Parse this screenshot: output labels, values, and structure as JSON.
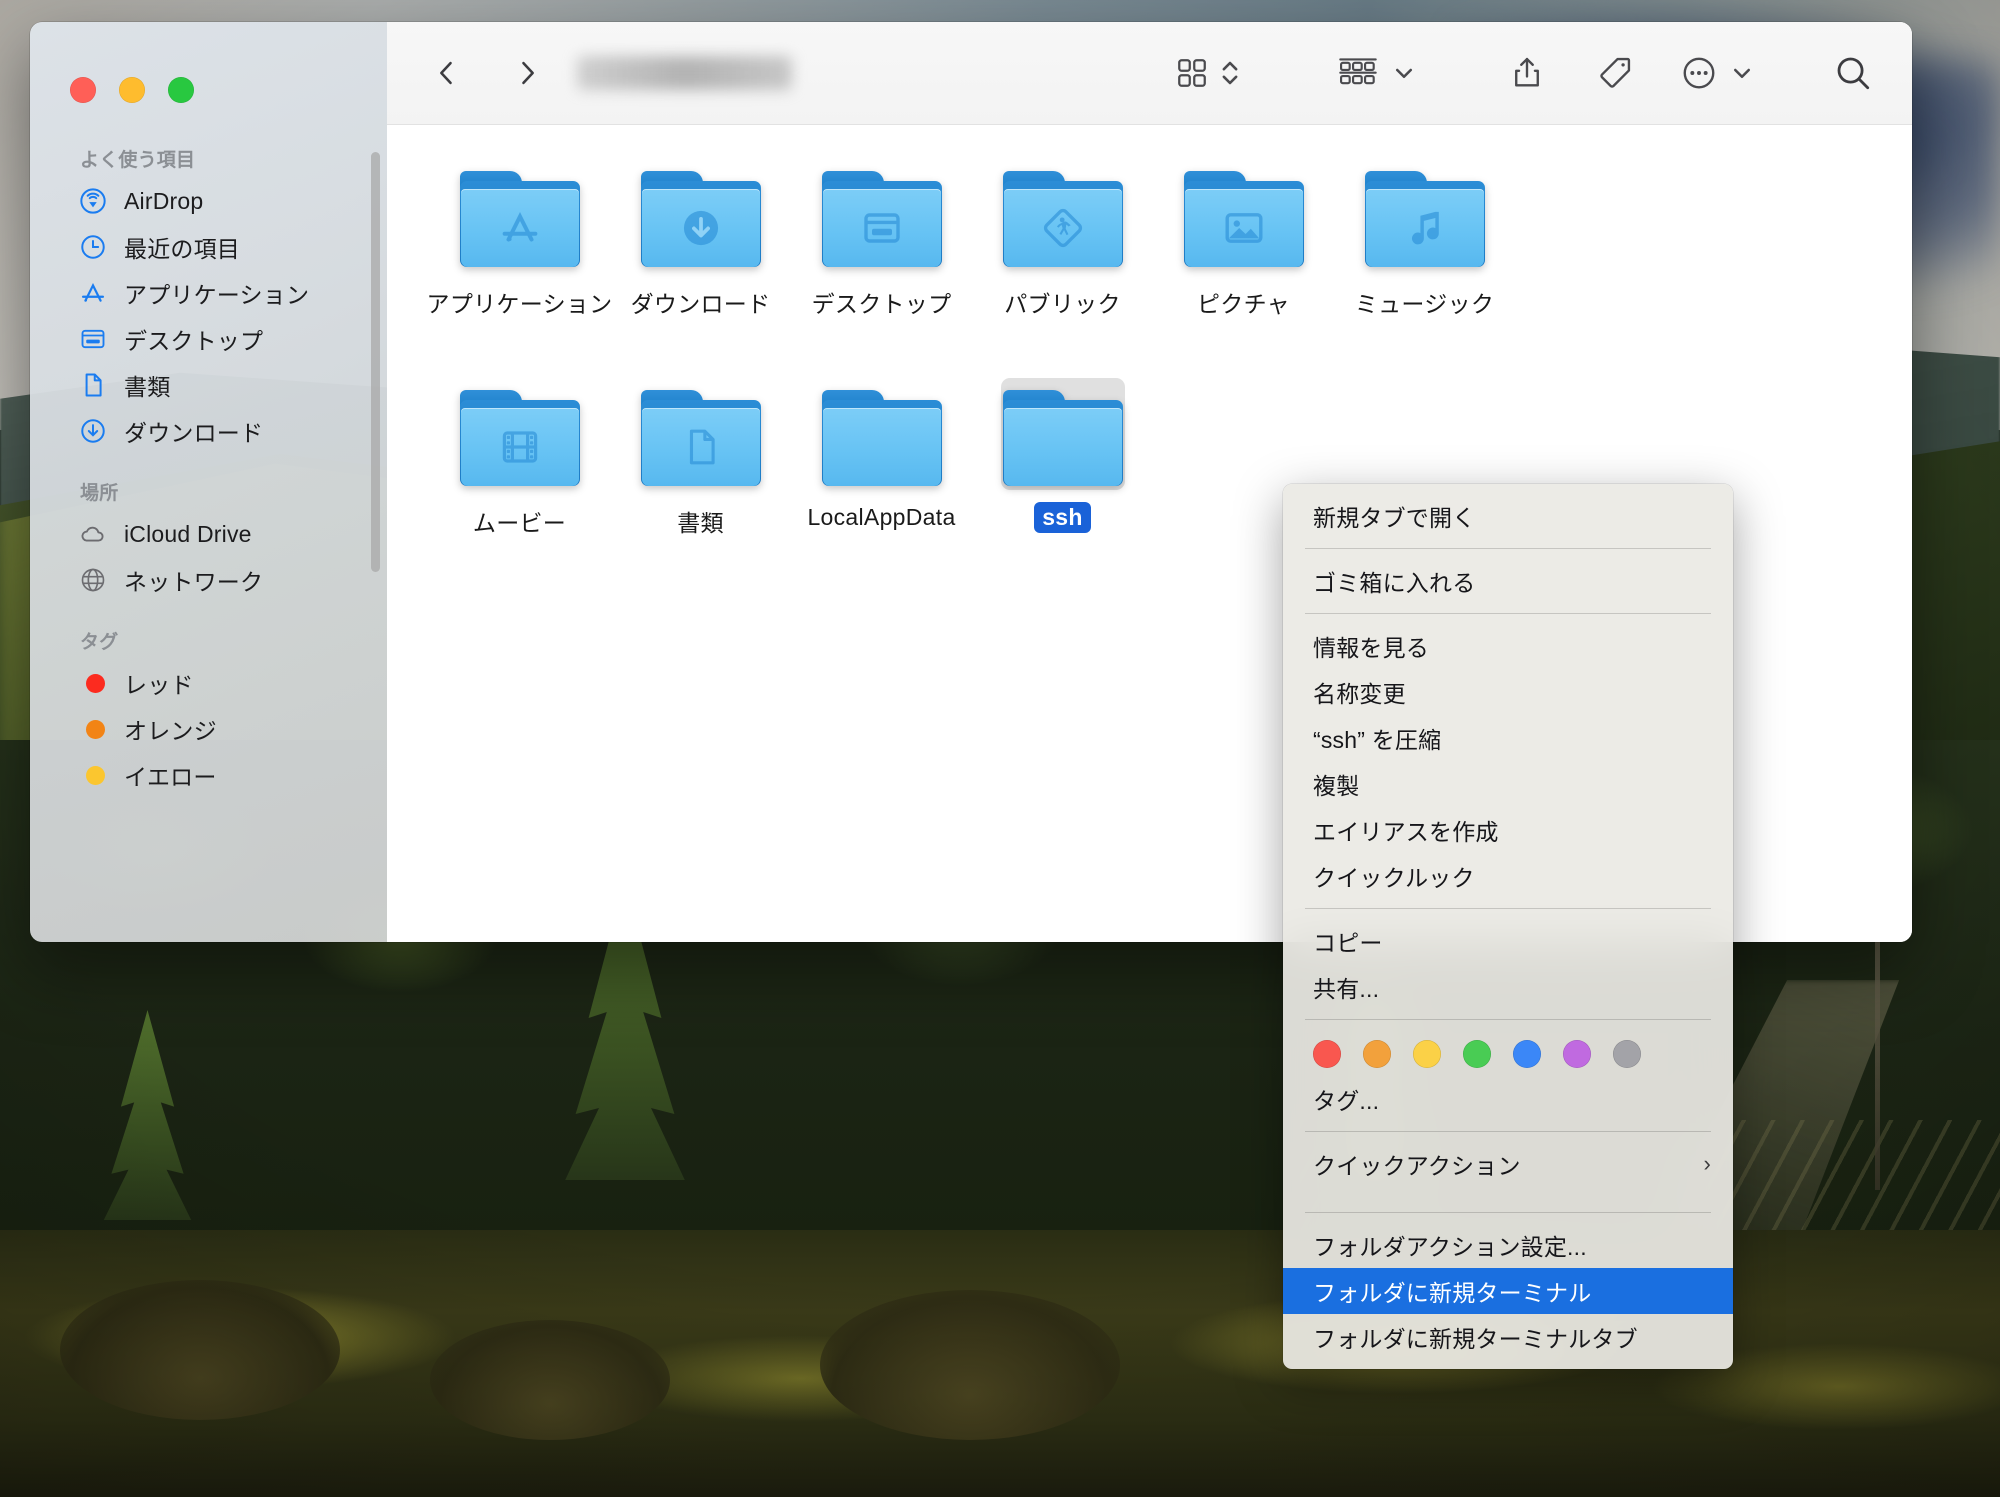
{
  "window": {
    "traffic_lights": [
      "close",
      "minimize",
      "zoom"
    ],
    "path_title_redacted": ""
  },
  "sidebar": {
    "sections": [
      {
        "heading": "よく使う項目",
        "items": [
          {
            "label": "AirDrop",
            "icon": "airdrop-icon"
          },
          {
            "label": "最近の項目",
            "icon": "clock-icon"
          },
          {
            "label": "アプリケーション",
            "icon": "appstore-icon"
          },
          {
            "label": "デスクトップ",
            "icon": "desktop-icon"
          },
          {
            "label": "書類",
            "icon": "document-icon"
          },
          {
            "label": "ダウンロード",
            "icon": "download-icon"
          }
        ]
      },
      {
        "heading": "場所",
        "items": [
          {
            "label": "iCloud Drive",
            "icon": "cloud-icon"
          },
          {
            "label": "ネットワーク",
            "icon": "globe-icon"
          }
        ]
      },
      {
        "heading": "タグ",
        "items": [
          {
            "label": "レッド",
            "icon": "tag-dot-icon",
            "color": "#fc2b1f"
          },
          {
            "label": "オレンジ",
            "icon": "tag-dot-icon",
            "color": "#f28415"
          },
          {
            "label": "イエロー",
            "icon": "tag-dot-icon",
            "color": "#fbc62f"
          }
        ]
      }
    ]
  },
  "toolbar": {
    "back": "back-icon",
    "forward": "forward-icon",
    "view_mode": "icon-view-icon",
    "view_stepper": "stepper-icon",
    "group_by": "group-by-icon",
    "group_chevron": "chevron-down-icon",
    "share": "share-icon",
    "tags": "tag-icon",
    "more": "ellipsis-circle-icon",
    "more_chevron": "chevron-down-icon",
    "search": "search-icon"
  },
  "files": {
    "rows": [
      [
        {
          "name": "アプリケーション",
          "icon": "folder-applications",
          "selected": false
        },
        {
          "name": "ダウンロード",
          "icon": "folder-downloads",
          "selected": false
        },
        {
          "name": "デスクトップ",
          "icon": "folder-desktop",
          "selected": false
        },
        {
          "name": "パブリック",
          "icon": "folder-public",
          "selected": false
        },
        {
          "name": "ピクチャ",
          "icon": "folder-pictures",
          "selected": false
        },
        {
          "name": "ミュージック",
          "icon": "folder-music",
          "selected": false
        }
      ],
      [
        {
          "name": "ムービー",
          "icon": "folder-movies",
          "selected": false
        },
        {
          "name": "書類",
          "icon": "folder-documents",
          "selected": false
        },
        {
          "name": "LocalAppData",
          "icon": "folder-plain",
          "selected": false
        },
        {
          "name": "ssh",
          "icon": "folder-plain",
          "selected": true
        }
      ]
    ]
  },
  "context_menu": {
    "items": [
      {
        "label": "新規タブで開く",
        "type": "item"
      },
      {
        "type": "separator"
      },
      {
        "label": "ゴミ箱に入れる",
        "type": "item"
      },
      {
        "type": "separator"
      },
      {
        "label": "情報を見る",
        "type": "item"
      },
      {
        "label": "名称変更",
        "type": "item"
      },
      {
        "label": "“ssh” を圧縮",
        "type": "item"
      },
      {
        "label": "複製",
        "type": "item"
      },
      {
        "label": "エイリアスを作成",
        "type": "item"
      },
      {
        "label": "クイックルック",
        "type": "item"
      },
      {
        "type": "separator"
      },
      {
        "label": "コピー",
        "type": "item"
      },
      {
        "label": "共有...",
        "type": "item"
      },
      {
        "type": "separator"
      },
      {
        "type": "swatches"
      },
      {
        "label": "タグ...",
        "type": "item"
      },
      {
        "type": "separator"
      },
      {
        "label": "クイックアクション",
        "type": "submenu",
        "chevron": "›"
      },
      {
        "type": "separator"
      },
      {
        "label": "フォルダアクション設定...",
        "type": "item"
      },
      {
        "label": "フォルダに新規ターミナル",
        "type": "item",
        "highlighted": true
      },
      {
        "label": "フォルダに新規ターミナルタブ",
        "type": "item"
      }
    ],
    "tag_colors": [
      "#f9574f",
      "#f2a13c",
      "#fbd147",
      "#49cc54",
      "#3b87f7",
      "#c06ae0",
      "#a3a3a8"
    ],
    "highlight_color": "#1a6fe0"
  },
  "colors": {
    "selection_blue": "#1a62d8",
    "folder_blue": "#67c3f4",
    "folder_dark_blue": "#1d7bc4",
    "sidebar_accent": "#1a7cf0"
  }
}
